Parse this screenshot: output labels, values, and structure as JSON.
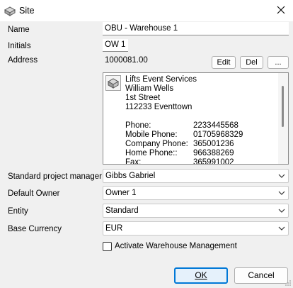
{
  "window": {
    "title": "Site"
  },
  "form": {
    "name_label": "Name",
    "name_value": "OBU - Warehouse 1",
    "initials_label": "Initials",
    "initials_value": "OW 1",
    "address_label": "Address",
    "address_id": "1000081.00",
    "edit_label": "Edit",
    "del_label": "Del",
    "more_label": "...",
    "address_lines": [
      "Lifts Event Services",
      "William Wells",
      "1st Street",
      "112233 Eventtown"
    ],
    "contacts": [
      {
        "label": "Phone:",
        "value": "2233445568"
      },
      {
        "label": "Mobile Phone:",
        "value": "01705968329"
      },
      {
        "label": "Company Phone:",
        "value": "365001236"
      },
      {
        "label": "Home Phone::",
        "value": "966388269"
      },
      {
        "label": "Fax:",
        "value": "365991002"
      }
    ],
    "pm_label": "Standard project manager",
    "pm_value": "Gibbs Gabriel",
    "owner_label": "Default Owner",
    "owner_value": "Owner 1",
    "entity_label": "Entity",
    "entity_value": "Standard",
    "currency_label": "Base Currency",
    "currency_value": "EUR",
    "warehouse_mgmt_label": "Activate Warehouse Management",
    "warehouse_mgmt_checked": false
  },
  "buttons": {
    "ok_label": "OK",
    "cancel_label": "Cancel"
  },
  "colors": {
    "accent": "#0078d7",
    "window_bg": "#f0f0f0",
    "field_bg": "#ffffff"
  },
  "icons": {
    "title": "site-icon",
    "close": "close-icon",
    "address": "building-icon",
    "dropdown": "chevron-down-icon"
  }
}
